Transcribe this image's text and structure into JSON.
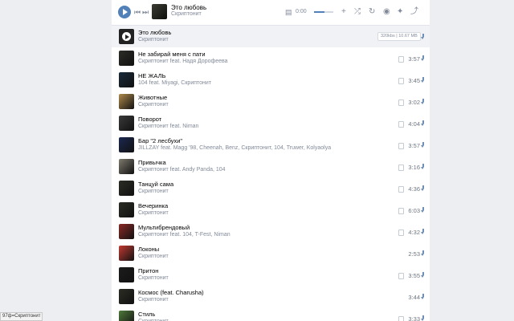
{
  "player": {
    "title": "Это любовь",
    "artist": "Скриптонит",
    "time": "0:00",
    "volume": 0.55,
    "controls": [
      "play",
      "prev",
      "next",
      "add",
      "shuffle",
      "repeat",
      "broadcast",
      "recommendations",
      "more"
    ]
  },
  "tracks": [
    {
      "title": "Это любовь",
      "artist": "Скриптонит",
      "duration": "",
      "bitrate": "320kbs | 10.67 MB",
      "active": true,
      "cover": "#222222"
    },
    {
      "title": "Не забирай меня с пати",
      "artist": "Скриптонит feat. Надя Дорофеева",
      "duration": "3:57",
      "lyrics": true,
      "cover": "#2b2d27"
    },
    {
      "title": "НЕ ЖАЛЬ",
      "artist": "104 feat. Miyagi, Скриптонит",
      "duration": "3:45",
      "lyrics": true,
      "cover": "#1a2a3a"
    },
    {
      "title": "Животные",
      "artist": "Скриптонит",
      "duration": "3:02",
      "lyrics": true,
      "cover": "#b08a4c"
    },
    {
      "title": "Поворот",
      "artist": "Скриптонит feat. Niman",
      "duration": "4:04",
      "lyrics": true,
      "cover": "#3a3a3a"
    },
    {
      "title": "Бар \"2 лесбухи\"",
      "artist": "JILLZAY feat. Magg '98, Cheenah, Benz, Скриптонит, 104, Truwer, Kolyaolya",
      "duration": "3:57",
      "lyrics": true,
      "cover": "#1b2850"
    },
    {
      "title": "Привычка",
      "artist": "Скриптонит feat. Andy Panda, 104",
      "duration": "3:16",
      "lyrics": true,
      "cover": "#7e7a6e"
    },
    {
      "title": "Танцуй сама",
      "artist": "Скриптонит",
      "duration": "4:36",
      "lyrics": true,
      "cover": "#2b2d24"
    },
    {
      "title": "Вечеринка",
      "artist": "Скриптонит",
      "duration": "6:03",
      "lyrics": true,
      "cover": "#2b2d24"
    },
    {
      "title": "Мультибрендовый",
      "artist": "Скриптонит feat. 104, T-Fest, Niman",
      "duration": "4:32",
      "lyrics": true,
      "cover": "#8a2a26"
    },
    {
      "title": "Локоны",
      "artist": "Скриптонит",
      "duration": "2:53",
      "lyrics": false,
      "cover": "#c23a32"
    },
    {
      "title": "Притон",
      "artist": "Скриптонит",
      "duration": "3:55",
      "lyrics": true,
      "cover": "#1c1c1c"
    },
    {
      "title": "Космос (feat. Charusha)",
      "artist": "Скриптонит",
      "duration": "3:44",
      "lyrics": false,
      "cover": "#2b2d24"
    },
    {
      "title": "Стиль",
      "artist": "Скриптонит",
      "duration": "3:33",
      "lyrics": true,
      "cover": "#4f7a3a"
    }
  ],
  "status_bar": "97ф=Скриптонит"
}
